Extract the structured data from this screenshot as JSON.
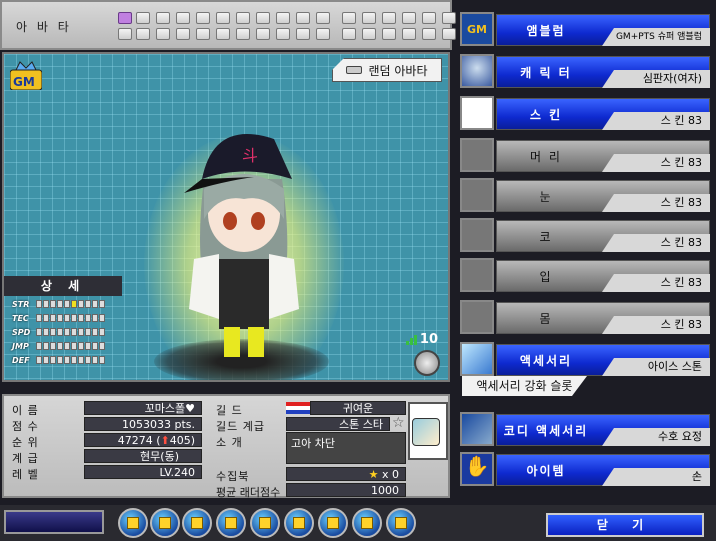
{
  "top": {
    "title": "아 바 타"
  },
  "viewer": {
    "random_button": "랜덤 아바타",
    "detail_title": "상 세",
    "stats": [
      {
        "label": "STR",
        "filled": 5
      },
      {
        "label": "TEC",
        "filled": 0
      },
      {
        "label": "SPD",
        "filled": 0
      },
      {
        "label": "JMP",
        "filled": 0
      },
      {
        "label": "DEF",
        "filled": 0
      }
    ],
    "level_indicator": "10"
  },
  "info": {
    "name_label": "이 름",
    "name_value": "꼬마스폴♥",
    "score_label": "점 수",
    "score_value": "1053033 pts.",
    "rank_label": "순 위",
    "rank_value": "47274 (",
    "rank_change": "405)",
    "class_label": "계 급",
    "class_value": "현무(동)",
    "level_label": "레 벨",
    "level_value": "LV.240",
    "guild_label": "길 드",
    "guild_value": "귀여운",
    "guild_rank_label": "길드 계급",
    "guild_rank_value": "스톤 스타",
    "intro_label": "소 개",
    "intro_value": "고아 차단",
    "collection_label": "수집북",
    "collection_value": "x 0",
    "ladder_label": "평균 래더점수",
    "ladder_value": "1000"
  },
  "menu": {
    "items": [
      {
        "label": "앰블럼",
        "value": "GM+PTS 슈퍼 앰블럼",
        "style": "blue"
      },
      {
        "label": "캐 릭 터",
        "value": "심판자(여자)",
        "style": "blue"
      },
      {
        "label": "스 킨",
        "value": "스 킨 83",
        "style": "blue"
      },
      {
        "label": "머 리",
        "value": "스 킨 83",
        "style": "gray"
      },
      {
        "label": "눈",
        "value": "스 킨 83",
        "style": "gray"
      },
      {
        "label": "코",
        "value": "스 킨 83",
        "style": "gray"
      },
      {
        "label": "입",
        "value": "스 킨 83",
        "style": "gray"
      },
      {
        "label": "몸",
        "value": "스 킨 83",
        "style": "gray"
      },
      {
        "label": "액세서리",
        "value": "아이스 스톤",
        "style": "blue"
      },
      {
        "label": "코디 액세서리",
        "value": "수호 요정",
        "style": "blue"
      },
      {
        "label": "아이템",
        "value": "손",
        "style": "blue"
      }
    ],
    "slot_label": "액세서리 강화 슬롯"
  },
  "bottom": {
    "close_label": "닫 기"
  },
  "colors": {
    "accent_blue": "#1e3ee0",
    "panel_gray": "#c4c4c4",
    "viewer_teal": "#3f93a8"
  }
}
